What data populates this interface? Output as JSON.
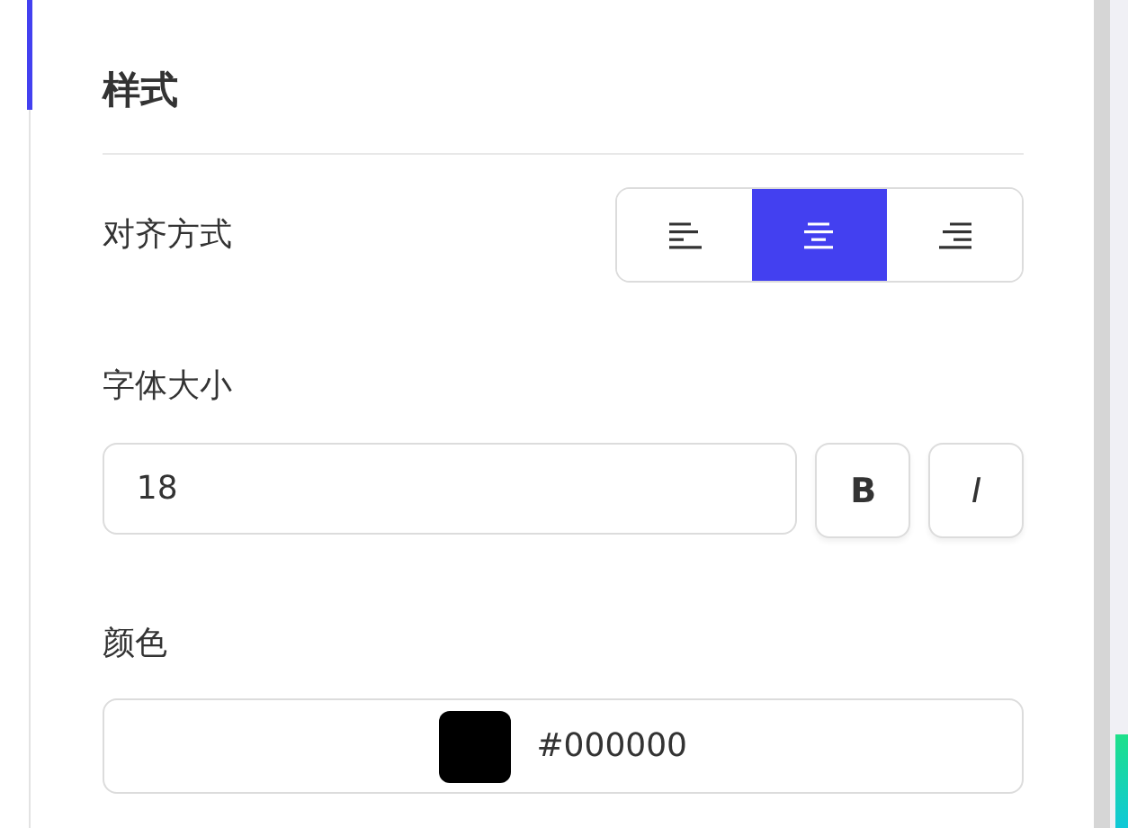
{
  "section": {
    "title": "样式"
  },
  "alignment": {
    "label": "对齐方式",
    "options": [
      {
        "kind": "left",
        "selected": false
      },
      {
        "kind": "center",
        "selected": true
      },
      {
        "kind": "right",
        "selected": false
      }
    ]
  },
  "font_size": {
    "label": "字体大小",
    "value": "18",
    "bold": {
      "label": "B",
      "on": false
    },
    "italic": {
      "label": "I",
      "on": false
    }
  },
  "color": {
    "label": "颜色",
    "color": "#000000",
    "value": "#000000"
  }
}
